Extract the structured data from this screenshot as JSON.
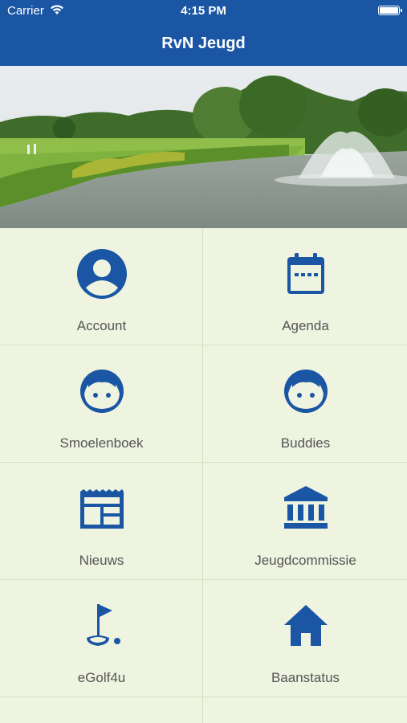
{
  "status_bar": {
    "carrier": "Carrier",
    "time": "4:15 PM"
  },
  "nav": {
    "title": "RvN Jeugd"
  },
  "colors": {
    "brand": "#1a56a4",
    "tile_bg": "#eef4e0",
    "label": "#555555"
  },
  "menu": [
    {
      "label": "Account",
      "icon": "account-icon"
    },
    {
      "label": "Agenda",
      "icon": "calendar-icon"
    },
    {
      "label": "Smoelenboek",
      "icon": "face-icon"
    },
    {
      "label": "Buddies",
      "icon": "face-icon"
    },
    {
      "label": "Nieuws",
      "icon": "newspaper-icon"
    },
    {
      "label": "Jeugdcommissie",
      "icon": "institution-icon"
    },
    {
      "label": "eGolf4u",
      "icon": "golf-flag-icon"
    },
    {
      "label": "Baanstatus",
      "icon": "home-icon"
    }
  ]
}
